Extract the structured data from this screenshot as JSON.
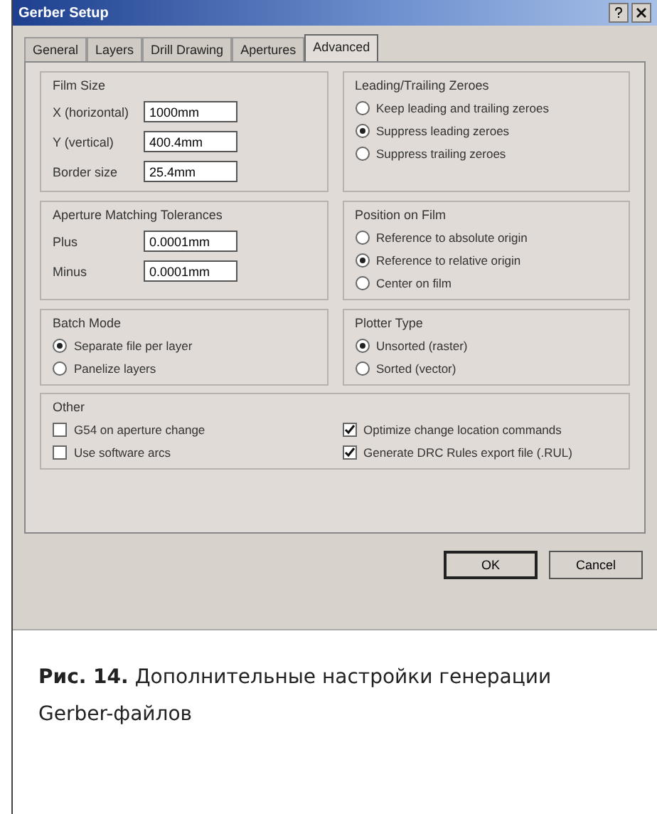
{
  "window": {
    "title": "Gerber Setup"
  },
  "tabs": [
    {
      "label": "General",
      "selected": false
    },
    {
      "label": "Layers",
      "selected": false
    },
    {
      "label": "Drill Drawing",
      "selected": false
    },
    {
      "label": "Apertures",
      "selected": false
    },
    {
      "label": "Advanced",
      "selected": true
    }
  ],
  "groups": [
    {
      "title": "Film Size",
      "fields": [
        {
          "label": "X (horizontal)",
          "value": "1000mm"
        },
        {
          "label": "Y (vertical)",
          "value": "400.4mm"
        },
        {
          "label": "Border size",
          "value": "25.4mm"
        }
      ]
    },
    {
      "title": "Leading/Trailing Zeroes",
      "options": [
        {
          "kind": "radio",
          "label": "Keep leading and trailing zeroes",
          "selected": false
        },
        {
          "kind": "radio",
          "label": "Suppress leading zeroes",
          "selected": true
        },
        {
          "kind": "radio",
          "label": "Suppress trailing zeroes",
          "selected": false
        }
      ]
    },
    {
      "title": "Aperture Matching Tolerances",
      "fields": [
        {
          "label": "Plus",
          "value": "0.0001mm"
        },
        {
          "label": "Minus",
          "value": "0.0001mm"
        }
      ]
    },
    {
      "title": "Position on Film",
      "options": [
        {
          "kind": "radio",
          "label": "Reference to absolute origin",
          "selected": false
        },
        {
          "kind": "radio",
          "label": "Reference to relative origin",
          "selected": true
        },
        {
          "kind": "radio",
          "label": "Center on film",
          "selected": false
        }
      ]
    },
    {
      "title": "Batch Mode",
      "options": [
        {
          "kind": "radio",
          "label": "Separate file per layer",
          "selected": true
        },
        {
          "kind": "radio",
          "label": "Panelize layers",
          "selected": false
        }
      ]
    },
    {
      "title": "Plotter Type",
      "options": [
        {
          "kind": "radio",
          "label": "Unsorted (raster)",
          "selected": true
        },
        {
          "kind": "radio",
          "label": "Sorted (vector)",
          "selected": false
        }
      ]
    }
  ],
  "other": {
    "title": "Other",
    "options": [
      {
        "kind": "checkbox",
        "label": "G54 on aperture change",
        "checked": false
      },
      {
        "kind": "checkbox",
        "label": "Optimize change location commands",
        "checked": true
      },
      {
        "kind": "checkbox",
        "label": "Use software arcs",
        "checked": false
      },
      {
        "kind": "checkbox",
        "label": "Generate DRC Rules export file (.RUL)",
        "checked": true
      }
    ]
  },
  "buttons": [
    "OK",
    "Cancel"
  ],
  "caption": "**Рис. 14.** Дополнительные настройки генерации Gerber-файлов"
}
